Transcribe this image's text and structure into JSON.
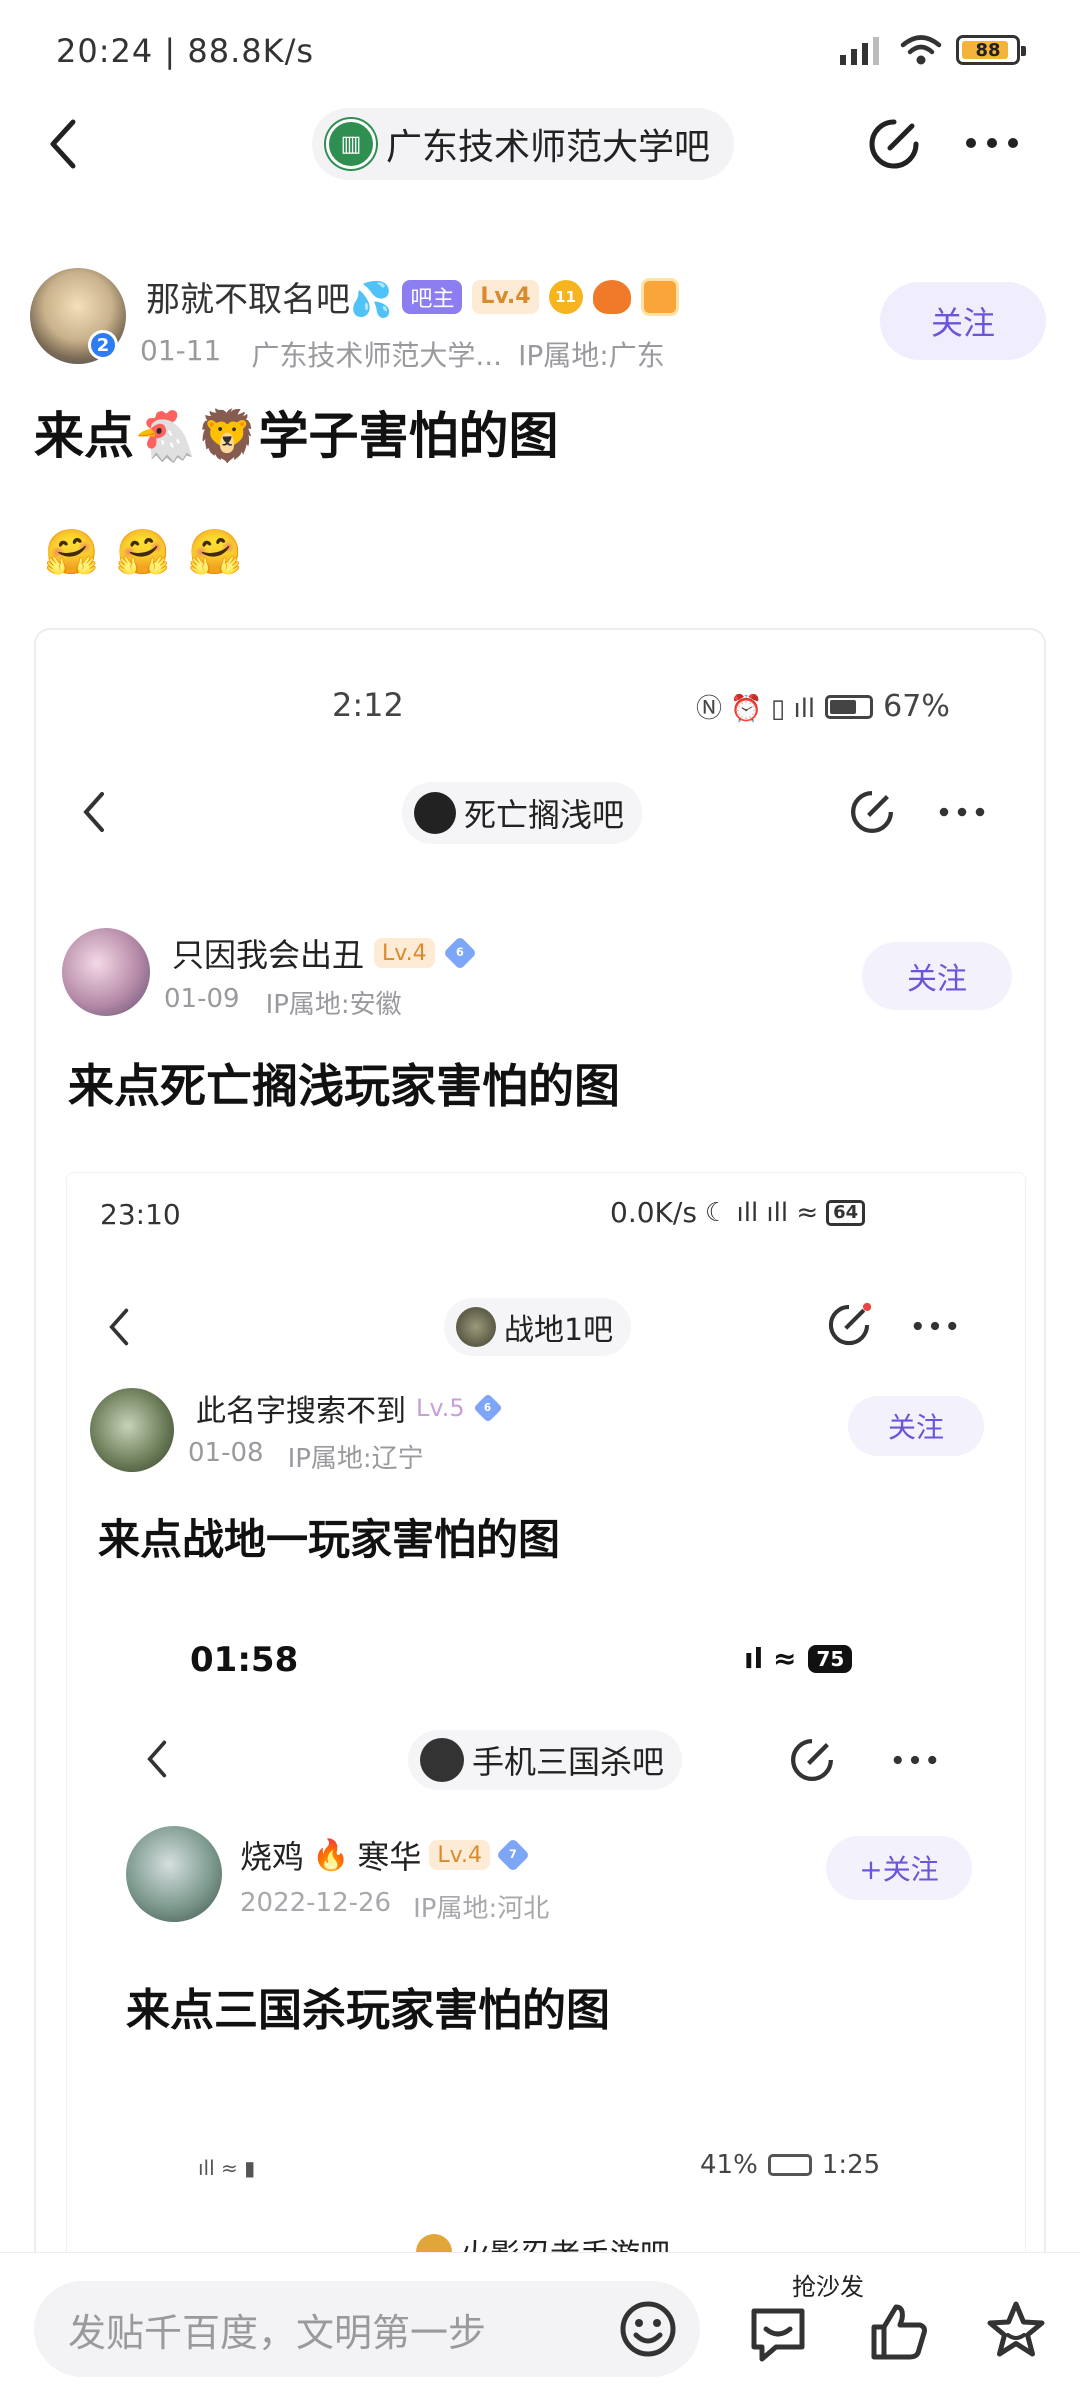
{
  "status": {
    "time": "20:24 | 88.8K/s",
    "battery": "88",
    "battery_level": 0.88
  },
  "header": {
    "forum_name": "广东技术师范大学吧"
  },
  "post": {
    "author": "那就不取名吧💦",
    "author_level_badge": "2",
    "owner_tag": "吧主",
    "level": "Lv.4",
    "badge_num": "11",
    "date": "01-11",
    "forum": "广东技术师范大学...",
    "ip": "IP属地:广东",
    "follow": "关注",
    "title": "来点🐔🦁学子害怕的图",
    "emojis": [
      "🤗",
      "🤗",
      "🤗"
    ]
  },
  "screenshot1": {
    "time": "2:12",
    "battery_text": "67%",
    "forum": "死亡搁浅吧",
    "author": "只因我会出丑",
    "level": "Lv.4",
    "badge_num": "6",
    "date": "01-09",
    "ip": "IP属地:安徽",
    "follow": "关注",
    "title": "来点死亡搁浅玩家害怕的图"
  },
  "screenshot2": {
    "time": "23:10",
    "speed": "0.0K/s",
    "battery": "64",
    "forum": "战地1吧",
    "author": "此名字搜索不到",
    "level": "Lv.5",
    "badge_num": "6",
    "date": "01-08",
    "ip": "IP属地:辽宁",
    "follow": "关注",
    "title": "来点战地一玩家害怕的图"
  },
  "screenshot3": {
    "time": "01:58",
    "battery": "75",
    "forum": "手机三国杀吧",
    "author_a": "烧鸡",
    "author_b": "寒华",
    "level": "Lv.4",
    "badge_num": "7",
    "date": "2022-12-26",
    "ip": "IP属地:河北",
    "follow": "+关注",
    "title": "来点三国杀玩家害怕的图"
  },
  "screenshot4": {
    "status_right": "41%",
    "time": "1:25",
    "forum": "火影忍者手游吧"
  },
  "bottom": {
    "placeholder": "发贴千百度，文明第一步",
    "sofa_label": "抢沙发"
  }
}
